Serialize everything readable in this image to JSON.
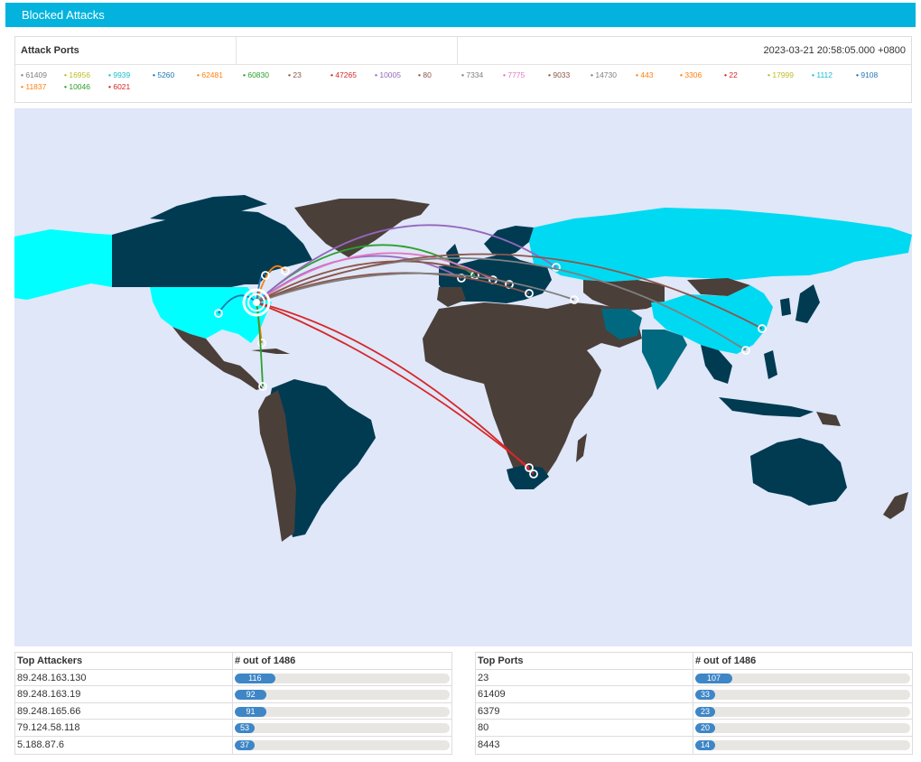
{
  "title": "Blocked Attacks",
  "ports_panel": {
    "heading": "Attack Ports",
    "timestamp": "2023-03-21 20:58:05.000 +0800",
    "legend": [
      {
        "label": "61409",
        "color": "#7f7f7f"
      },
      {
        "label": "16956",
        "color": "#bcbd22"
      },
      {
        "label": "9939",
        "color": "#17becf"
      },
      {
        "label": "5260",
        "color": "#1f77b4"
      },
      {
        "label": "62481",
        "color": "#ff7f0e"
      },
      {
        "label": "60830",
        "color": "#2ca02c"
      },
      {
        "label": "23",
        "color": "#8c564b"
      },
      {
        "label": "47265",
        "color": "#d62728"
      },
      {
        "label": "10005",
        "color": "#9467bd"
      },
      {
        "label": "80",
        "color": "#8c564b"
      },
      {
        "label": "7334",
        "color": "#7f7f7f"
      },
      {
        "label": "7775",
        "color": "#e377c2"
      },
      {
        "label": "9033",
        "color": "#8c564b"
      },
      {
        "label": "14730",
        "color": "#7f7f7f"
      },
      {
        "label": "443",
        "color": "#ff7f0e"
      },
      {
        "label": "3306",
        "color": "#ff7f0e"
      },
      {
        "label": "22",
        "color": "#d62728"
      },
      {
        "label": "17999",
        "color": "#bcbd22"
      },
      {
        "label": "1112",
        "color": "#17becf"
      },
      {
        "label": "9108",
        "color": "#1f77b4"
      },
      {
        "label": "11837",
        "color": "#ff7f0e"
      },
      {
        "label": "10046",
        "color": "#2ca02c"
      },
      {
        "label": "6021",
        "color": "#d62728"
      }
    ]
  },
  "map": {
    "ocean_color": "#dfe7f8",
    "land_dark": "#4b3f3a",
    "land_navy": "#003b52",
    "land_teal": "#00697f",
    "land_cyan": "#00d9f2",
    "land_aqua": "#00ffff"
  },
  "top_attackers": {
    "col1": "Top Attackers",
    "col2": "# out of 1486",
    "total": 1486,
    "rows": [
      {
        "key": "89.248.163.130",
        "count": 116
      },
      {
        "key": "89.248.163.19",
        "count": 92
      },
      {
        "key": "89.248.165.66",
        "count": 91
      },
      {
        "key": "79.124.58.118",
        "count": 53
      },
      {
        "key": "5.188.87.6",
        "count": 37
      }
    ]
  },
  "top_ports": {
    "col1": "Top Ports",
    "col2": "# out of 1486",
    "total": 1486,
    "rows": [
      {
        "key": "23",
        "count": 107
      },
      {
        "key": "61409",
        "count": 33
      },
      {
        "key": "6379",
        "count": 23
      },
      {
        "key": "80",
        "count": 20
      },
      {
        "key": "8443",
        "count": 14
      }
    ]
  }
}
